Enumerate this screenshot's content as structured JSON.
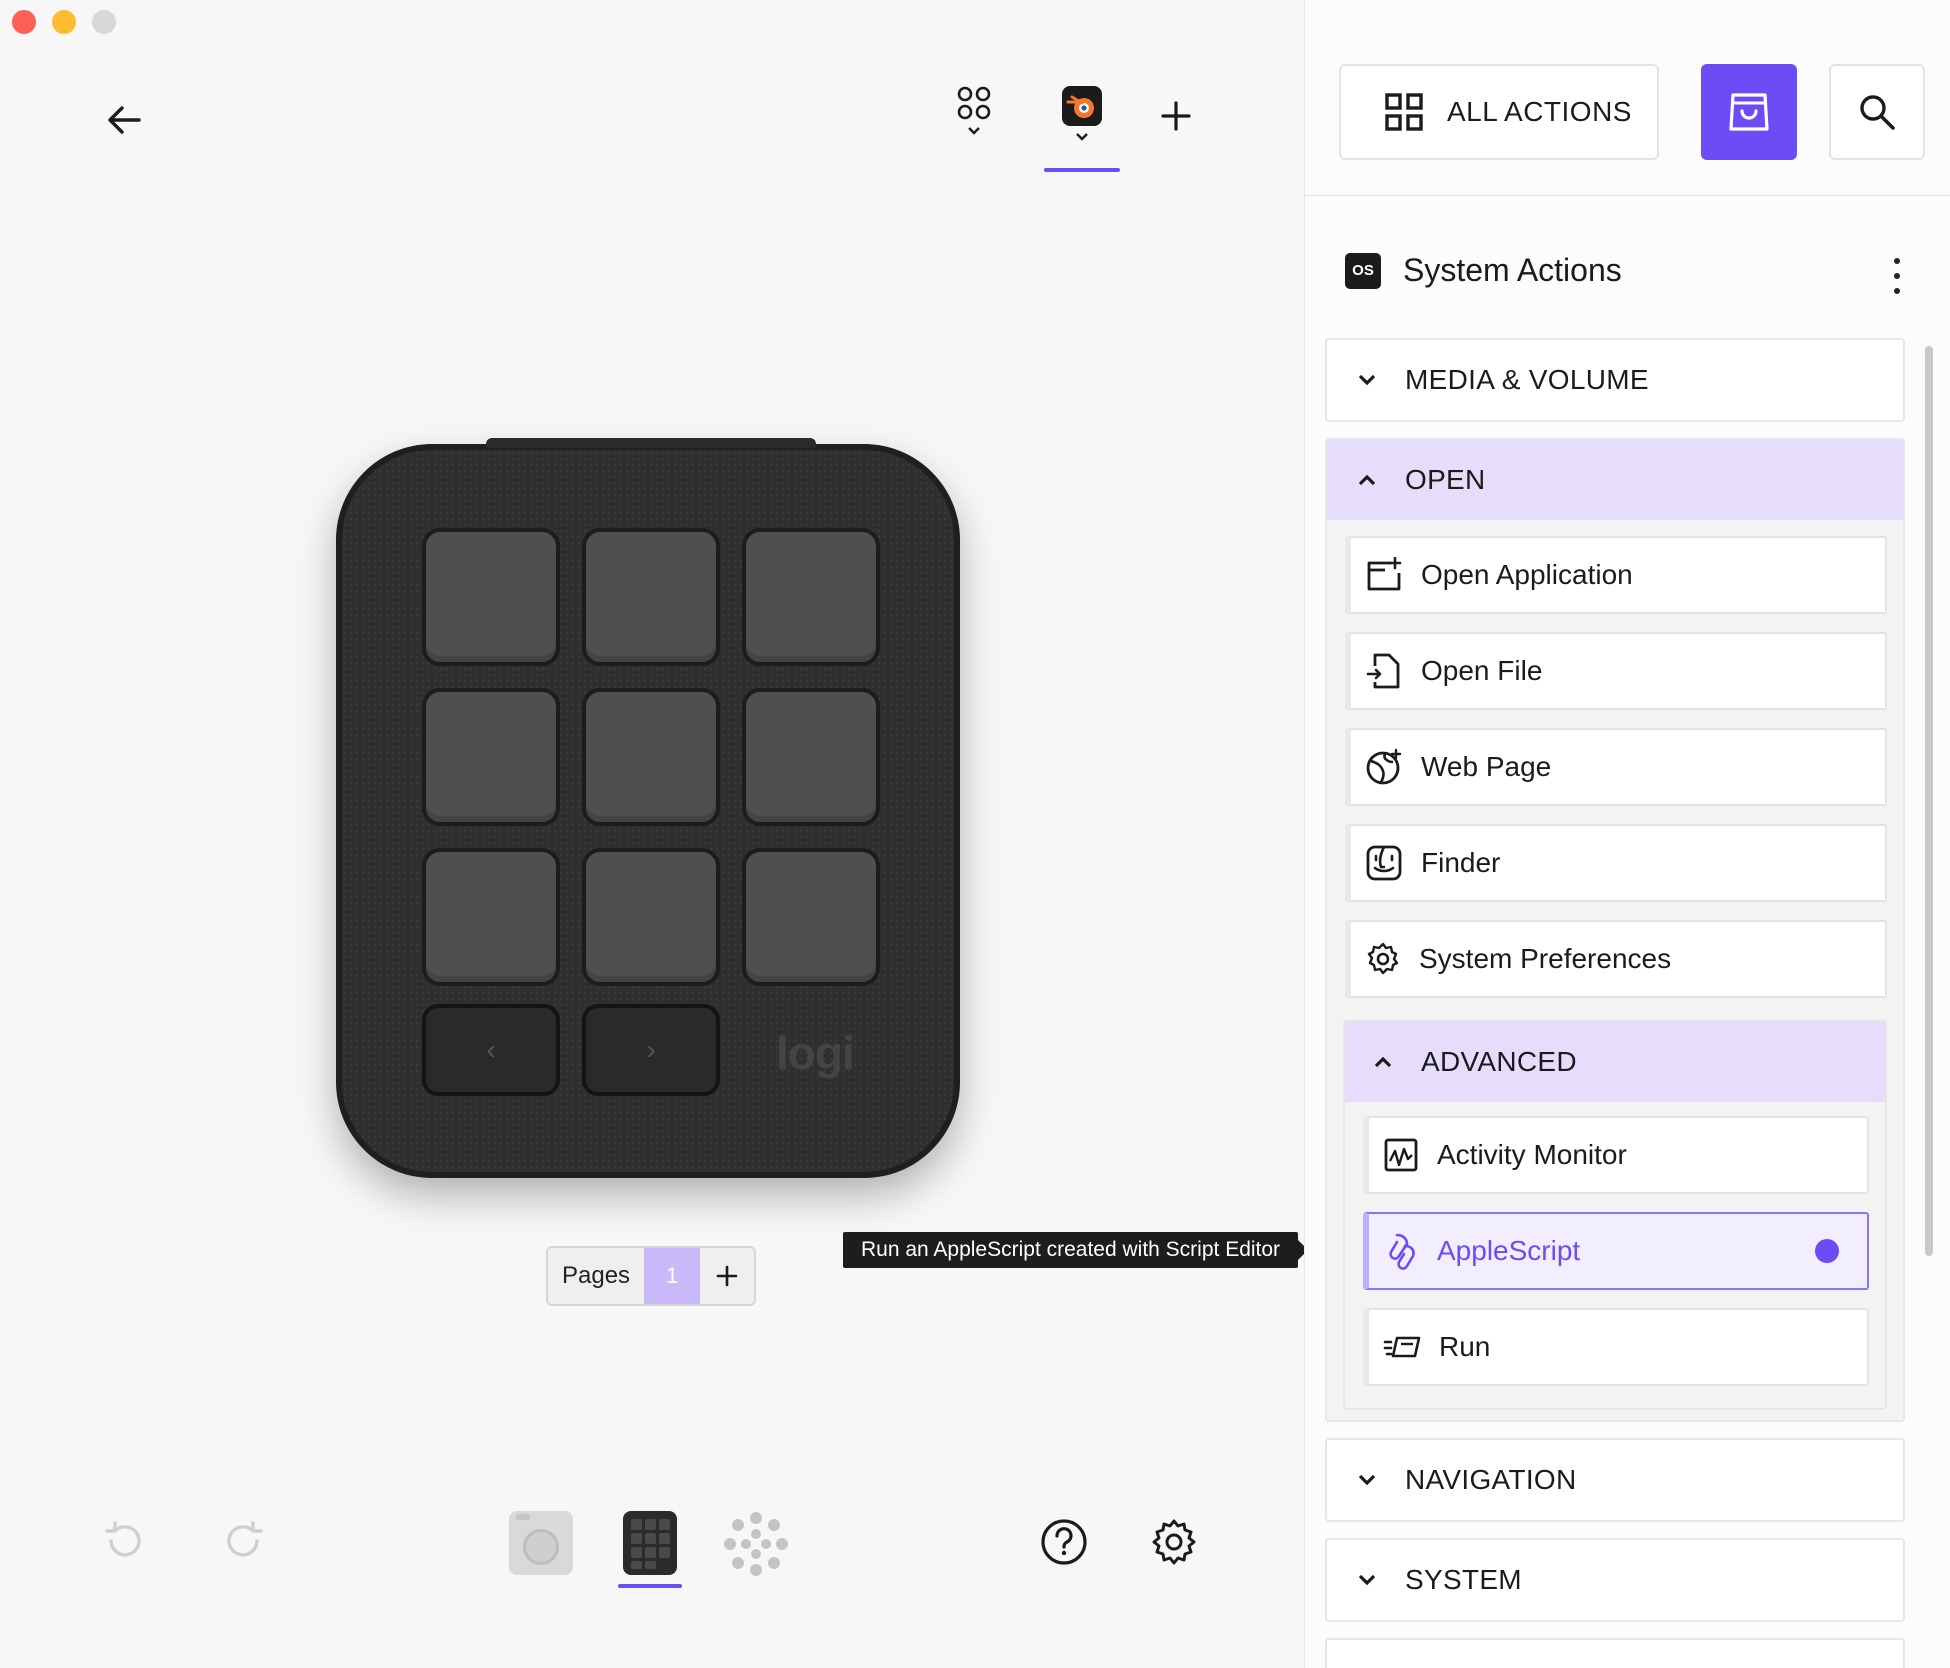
{
  "window": {
    "controls": [
      "close",
      "minimize",
      "maximize"
    ]
  },
  "toolbar": {
    "back_icon": "arrow-left-icon",
    "profiles": [
      {
        "icon": "apps-grid-icon",
        "active": false
      },
      {
        "icon": "blender-icon",
        "active": true
      }
    ],
    "add_icon": "plus-icon"
  },
  "device": {
    "brand_label": "logi",
    "key_count": 9,
    "prev_glyph": "‹",
    "next_glyph": "›"
  },
  "pages": {
    "label": "Pages",
    "current": "1",
    "add_glyph": "+"
  },
  "tooltip": {
    "text": "Run an AppleScript created with Script Editor"
  },
  "bottom_bar": {
    "undo_icon": "undo-icon",
    "redo_icon": "redo-icon",
    "device_views": [
      "camera-device-icon",
      "keypad-device-icon",
      "dial-device-icon"
    ],
    "active_view": "keypad-device-icon",
    "help_icon": "help-icon",
    "settings_icon": "gear-icon"
  },
  "panel": {
    "all_actions_label": "ALL ACTIONS",
    "store_icon": "store-bag-icon",
    "search_icon": "search-icon",
    "os_badge": "OS",
    "title": "System Actions",
    "sections": {
      "media_volume": "MEDIA & VOLUME",
      "open": "OPEN",
      "advanced": "ADVANCED",
      "navigation": "NAVIGATION",
      "system": "SYSTEM"
    },
    "open_items": [
      {
        "label": "Open Application",
        "icon": "app-window-icon"
      },
      {
        "label": "Open File",
        "icon": "file-open-icon"
      },
      {
        "label": "Web Page",
        "icon": "globe-icon"
      },
      {
        "label": "Finder",
        "icon": "finder-icon"
      },
      {
        "label": "System Preferences",
        "icon": "settings-cog-icon"
      }
    ],
    "advanced_items": [
      {
        "label": "Activity Monitor",
        "icon": "activity-chart-icon"
      },
      {
        "label": "AppleScript",
        "icon": "applescript-icon",
        "selected": true
      },
      {
        "label": "Run",
        "icon": "run-command-icon"
      }
    ],
    "accent_color": "#6d4bf5",
    "section_open_bg": "#e5ddfb"
  }
}
